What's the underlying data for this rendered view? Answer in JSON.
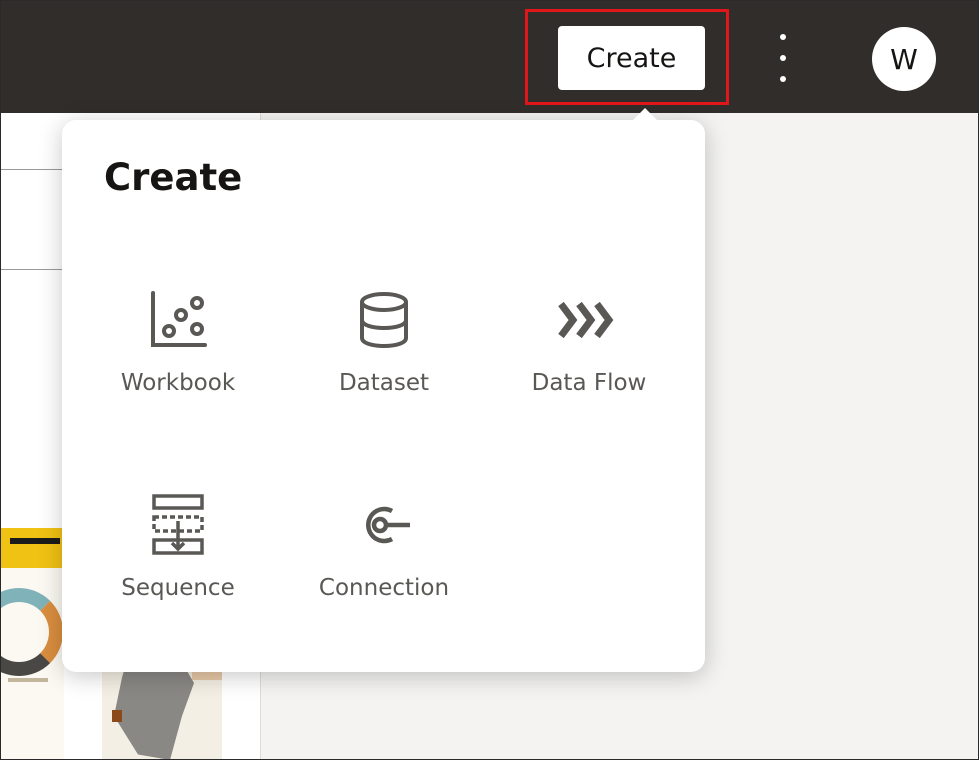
{
  "header": {
    "create_label": "Create",
    "more_icon": "vertical-ellipsis-icon",
    "avatar_initial": "W"
  },
  "popup": {
    "title": "Create",
    "items": [
      {
        "label": "Workbook",
        "icon": "scatter-chart-icon"
      },
      {
        "label": "Dataset",
        "icon": "database-icon"
      },
      {
        "label": "Data Flow",
        "icon": "data-flow-chevrons-icon"
      },
      {
        "label": "Sequence",
        "icon": "sequence-icon"
      },
      {
        "label": "Connection",
        "icon": "connection-plug-icon"
      }
    ]
  },
  "colors": {
    "topbar": "#312d2a",
    "highlight": "#e0161b",
    "icon": "#5a5855"
  }
}
